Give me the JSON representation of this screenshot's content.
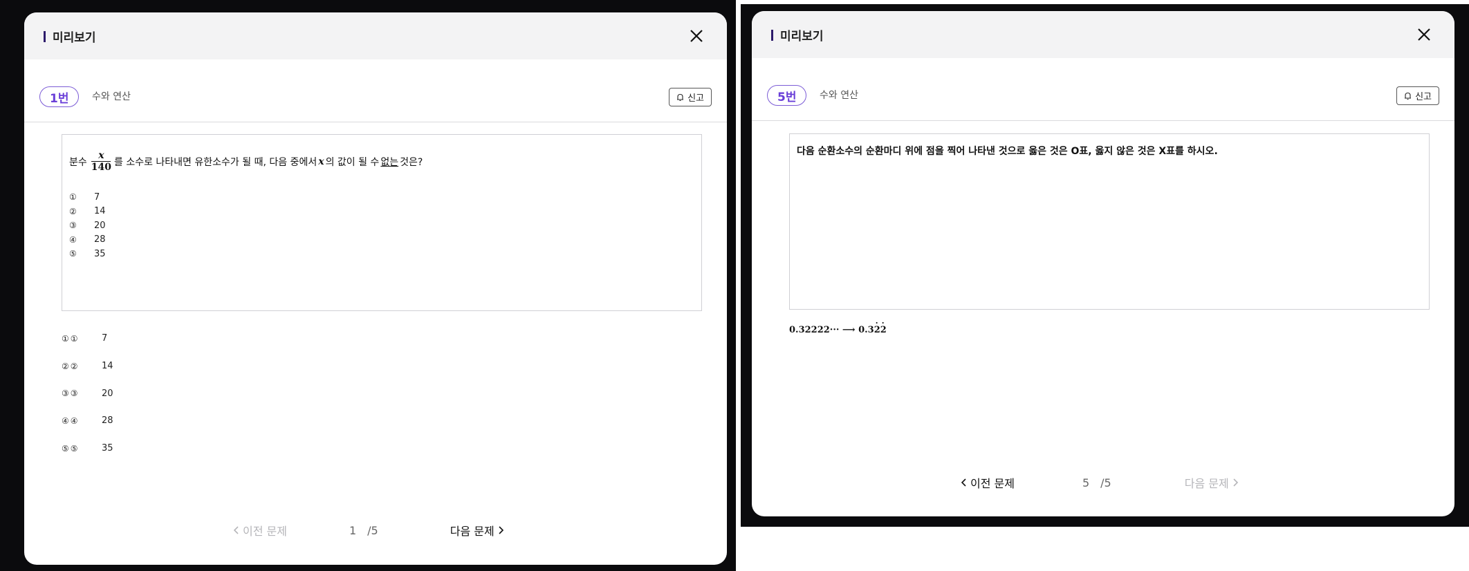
{
  "preview_left": {
    "title": "미리보기",
    "badge": "1번",
    "category": "수와 연산",
    "report_label": "신고",
    "question": {
      "prefix": "분수",
      "frac_num": "x",
      "frac_den": "140",
      "middle": "를 소수로 나타내면 유한소수가 될 때, 다음 중에서",
      "var": "x",
      "after_var": "의 값이 될 수",
      "underline": "없는",
      "suffix": "것은?"
    },
    "choices": [
      {
        "mark": "①",
        "value": "7"
      },
      {
        "mark": "②",
        "value": "14"
      },
      {
        "mark": "③",
        "value": "20"
      },
      {
        "mark": "④",
        "value": "28"
      },
      {
        "mark": "⑤",
        "value": "35"
      }
    ],
    "answers": [
      {
        "marks": "①①",
        "value": "7"
      },
      {
        "marks": "②②",
        "value": "14"
      },
      {
        "marks": "③③",
        "value": "20"
      },
      {
        "marks": "④④",
        "value": "28"
      },
      {
        "marks": "⑤⑤",
        "value": "35"
      }
    ],
    "pager": {
      "prev": "이전 문제",
      "current": "1",
      "total": "/5",
      "next": "다음 문제"
    }
  },
  "preview_right": {
    "title": "미리보기",
    "badge": "5번",
    "category": "수와 연산",
    "report_label": "신고",
    "question_text": "다음 순환소수의 순환마디 위에 점을 찍어 나타낸 것으로 옳은 것은 O표, 옳지 않은 것은 X표를 하시오.",
    "formula": {
      "left": "0.32222···",
      "arrow": "⟶",
      "right_base": "0.3",
      "dot_digits": [
        "2",
        "2"
      ]
    },
    "pager": {
      "prev": "이전 문제",
      "current": "5",
      "total": "/5",
      "next": "다음 문제"
    }
  },
  "icons": {
    "close": "close-icon",
    "report": "bell-icon",
    "prev": "chevron-left-icon",
    "next": "chevron-right-icon"
  }
}
